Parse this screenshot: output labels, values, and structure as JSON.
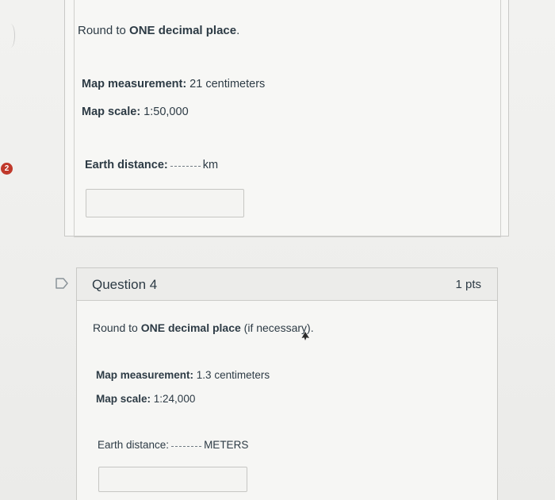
{
  "question_prev": {
    "badge_number": "2",
    "instruction_prefix": "Round to ",
    "instruction_bold": "ONE decimal place",
    "instruction_suffix": ".",
    "measurement_label": "Map measurement:",
    "measurement_value": " 21 centimeters",
    "scale_label": "Map scale:",
    "scale_value": " 1:50,000",
    "earth_label": "Earth distance:",
    "earth_unit": "km",
    "answer_value": ""
  },
  "question_4": {
    "title": "Question 4",
    "points": "1 pts",
    "instruction_prefix": "Round to ",
    "instruction_bold": "ONE decimal place",
    "instruction_suffix": " (if necessary).",
    "measurement_label": "Map measurement:",
    "measurement_value": " 1.3 centimeters",
    "scale_label": "Map scale:",
    "scale_value": " 1:24,000",
    "earth_label": "Earth distance:",
    "earth_unit": "METERS",
    "answer_value": ""
  },
  "icons": {
    "flag": "flag-outline-icon",
    "cursor": "mouse-pointer-icon"
  },
  "colors": {
    "badge": "#c0392b",
    "text": "#2d3b45",
    "border": "#c9c9c6"
  }
}
